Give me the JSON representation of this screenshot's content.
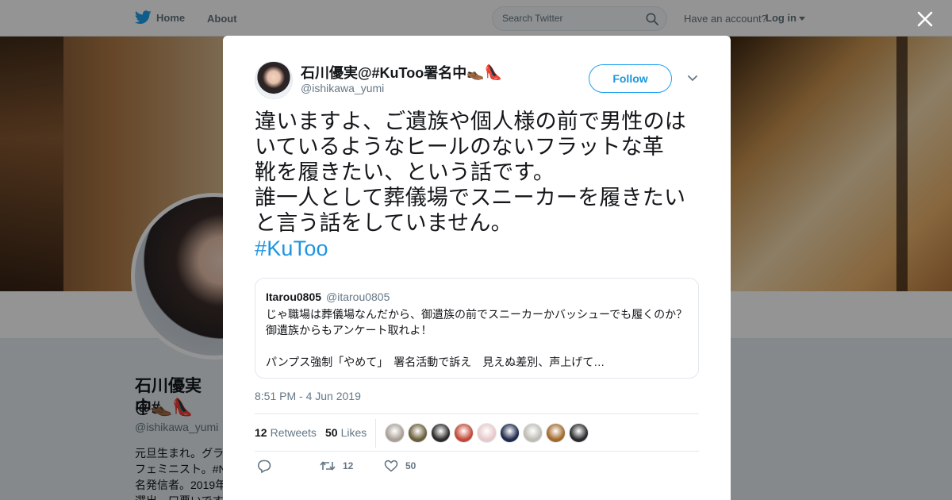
{
  "nav": {
    "home_label": "Home",
    "about_label": "About",
    "search_placeholder": "Search Twitter",
    "have_account": "Have an account?",
    "login_label": "Log in"
  },
  "background_profile": {
    "name_line1": "石川優実@#",
    "name_line2": "中👞👠",
    "handle": "@ishikawa_yumi",
    "bio_lines": [
      "元旦生まれ。グラ",
      "フェミニスト。#N",
      "名発信者。2019年",
      "選出。口悪いです"
    ]
  },
  "tweet": {
    "author_name": "石川優実@#KuToo署名中",
    "author_emoji": "👞👠",
    "author_handle": "@ishikawa_yumi",
    "follow_label": "Follow",
    "text_lines": [
      "違いますよ、ご遺族や個人様の前で男性のは",
      "いているようなヒールのないフラットな革",
      "靴を履きたい、という話です。",
      "誰一人として葬儀場でスニーカーを履きたい",
      "と言う話をしていません。"
    ],
    "hashtag": "#KuToo",
    "quoted": {
      "name": "Itarou0805",
      "handle": "@itarou0805",
      "text_lines": [
        "じゃ職場は葬儀場なんだから、御遺族の前でスニーカーかバッシューでも履くのか？",
        "御遺族からもアンケート取れよ！",
        "",
        "パンプス強制「やめて」　署名活動で訴え　見えぬ差別、声上げて…"
      ]
    },
    "timestamp": "8:51 PM - 4 Jun 2019",
    "retweets_count": "12",
    "retweets_label": "Retweets",
    "likes_count": "50",
    "likes_label": "Likes",
    "action_retweet_count": "12",
    "action_like_count": "50"
  },
  "colors": {
    "accent": "#1da1f2",
    "link": "#1b95e0",
    "secondary_text": "#657786",
    "border": "#e1e8ed"
  },
  "liker_colors": [
    "#a99f95",
    "#6b5e3a",
    "#2e2a2a",
    "#c44836",
    "#e8c9c9",
    "#1f2a4a",
    "#bfbcb4",
    "#a2692a",
    "#2a2a2a"
  ]
}
